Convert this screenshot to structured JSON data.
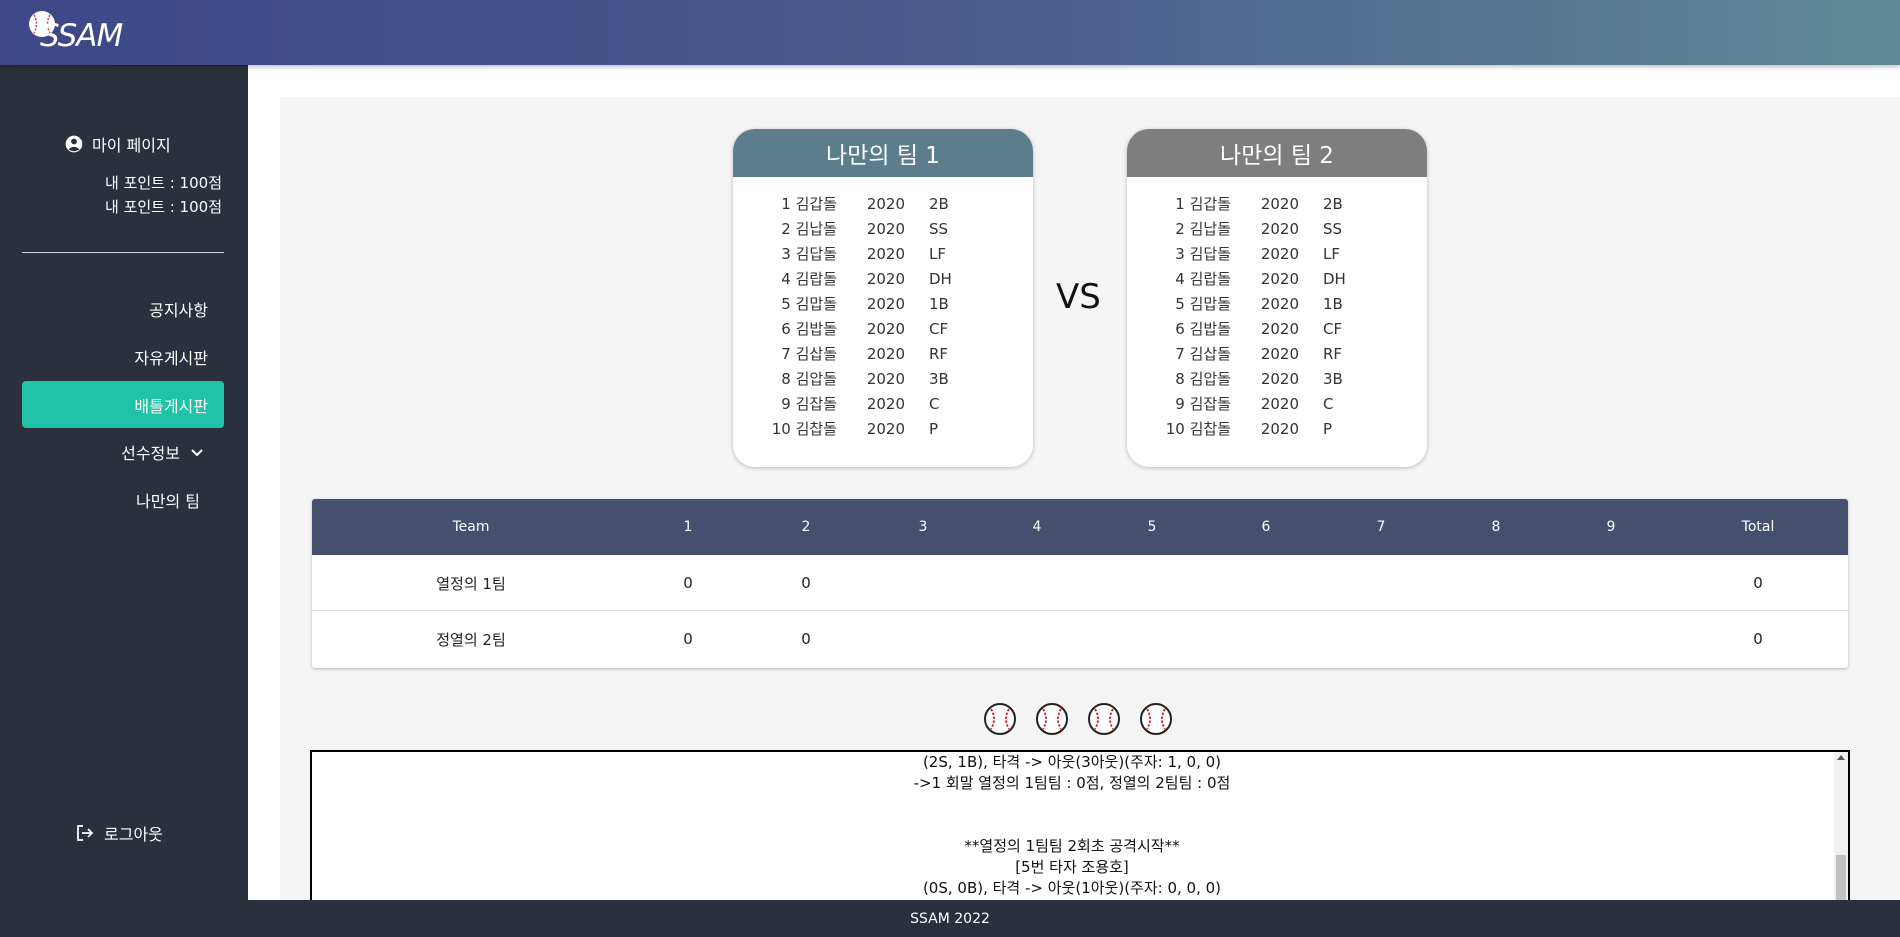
{
  "app": {
    "logo_text": "SSAM"
  },
  "sidebar": {
    "mypage_label": "마이 페이지",
    "points": [
      "내 포인트 : 100점",
      "내 포인트 : 100점"
    ],
    "nav": [
      {
        "label": "공지사항"
      },
      {
        "label": "자유게시판"
      },
      {
        "label": "배틀게시판",
        "active": true
      },
      {
        "label": "선수정보",
        "has_dropdown": true
      },
      {
        "label": "나만의 팀"
      }
    ],
    "logout_label": "로그아웃"
  },
  "teams": [
    {
      "title": "나만의 팀 1",
      "color": "#5b7d8c",
      "players": [
        {
          "no": "1",
          "name": "김갑돌",
          "year": "2020",
          "pos": "2B"
        },
        {
          "no": "2",
          "name": "김납돌",
          "year": "2020",
          "pos": "SS"
        },
        {
          "no": "3",
          "name": "김답돌",
          "year": "2020",
          "pos": "LF"
        },
        {
          "no": "4",
          "name": "김랍돌",
          "year": "2020",
          "pos": "DH"
        },
        {
          "no": "5",
          "name": "김맙돌",
          "year": "2020",
          "pos": "1B"
        },
        {
          "no": "6",
          "name": "김밥돌",
          "year": "2020",
          "pos": "CF"
        },
        {
          "no": "7",
          "name": "김삽돌",
          "year": "2020",
          "pos": "RF"
        },
        {
          "no": "8",
          "name": "김압돌",
          "year": "2020",
          "pos": "3B"
        },
        {
          "no": "9",
          "name": "김잡돌",
          "year": "2020",
          "pos": "C"
        },
        {
          "no": "10",
          "name": "김찹돌",
          "year": "2020",
          "pos": "P"
        }
      ]
    },
    {
      "title": "나만의 팀 2",
      "color": "#7e7e7e",
      "players": [
        {
          "no": "1",
          "name": "김갑돌",
          "year": "2020",
          "pos": "2B"
        },
        {
          "no": "2",
          "name": "김납돌",
          "year": "2020",
          "pos": "SS"
        },
        {
          "no": "3",
          "name": "김답돌",
          "year": "2020",
          "pos": "LF"
        },
        {
          "no": "4",
          "name": "김랍돌",
          "year": "2020",
          "pos": "DH"
        },
        {
          "no": "5",
          "name": "김맙돌",
          "year": "2020",
          "pos": "1B"
        },
        {
          "no": "6",
          "name": "김밥돌",
          "year": "2020",
          "pos": "CF"
        },
        {
          "no": "7",
          "name": "김삽돌",
          "year": "2020",
          "pos": "RF"
        },
        {
          "no": "8",
          "name": "김압돌",
          "year": "2020",
          "pos": "3B"
        },
        {
          "no": "9",
          "name": "김잡돌",
          "year": "2020",
          "pos": "C"
        },
        {
          "no": "10",
          "name": "김찹돌",
          "year": "2020",
          "pos": "P"
        }
      ]
    }
  ],
  "vs_label": "VS",
  "scoreboard": {
    "headers": [
      "Team",
      "1",
      "2",
      "3",
      "4",
      "5",
      "6",
      "7",
      "8",
      "9",
      "Total"
    ],
    "rows": [
      {
        "team": "열정의 1팀",
        "innings": [
          "0",
          "0",
          "",
          "",
          "",
          "",
          "",
          "",
          ""
        ],
        "total": "0"
      },
      {
        "team": "정열의 2팀",
        "innings": [
          "0",
          "0",
          "",
          "",
          "",
          "",
          "",
          "",
          ""
        ],
        "total": "0"
      }
    ]
  },
  "balls_count": 4,
  "log_lines": [
    "(2S, 1B), 타격 -> 아웃(3아웃)(주자: 1, 0, 0)",
    "->1 회말 열정의 1팀팀 : 0점, 정열의 2팀팀 : 0점",
    "",
    "",
    "**열정의 1팀팀 2회초 공격시작**",
    "[5번 타자 조용호]",
    "(0S, 0B), 타격 -> 아웃(1아웃)(주자: 0, 0, 0)"
  ],
  "footer_text": "SSAM 2022"
}
